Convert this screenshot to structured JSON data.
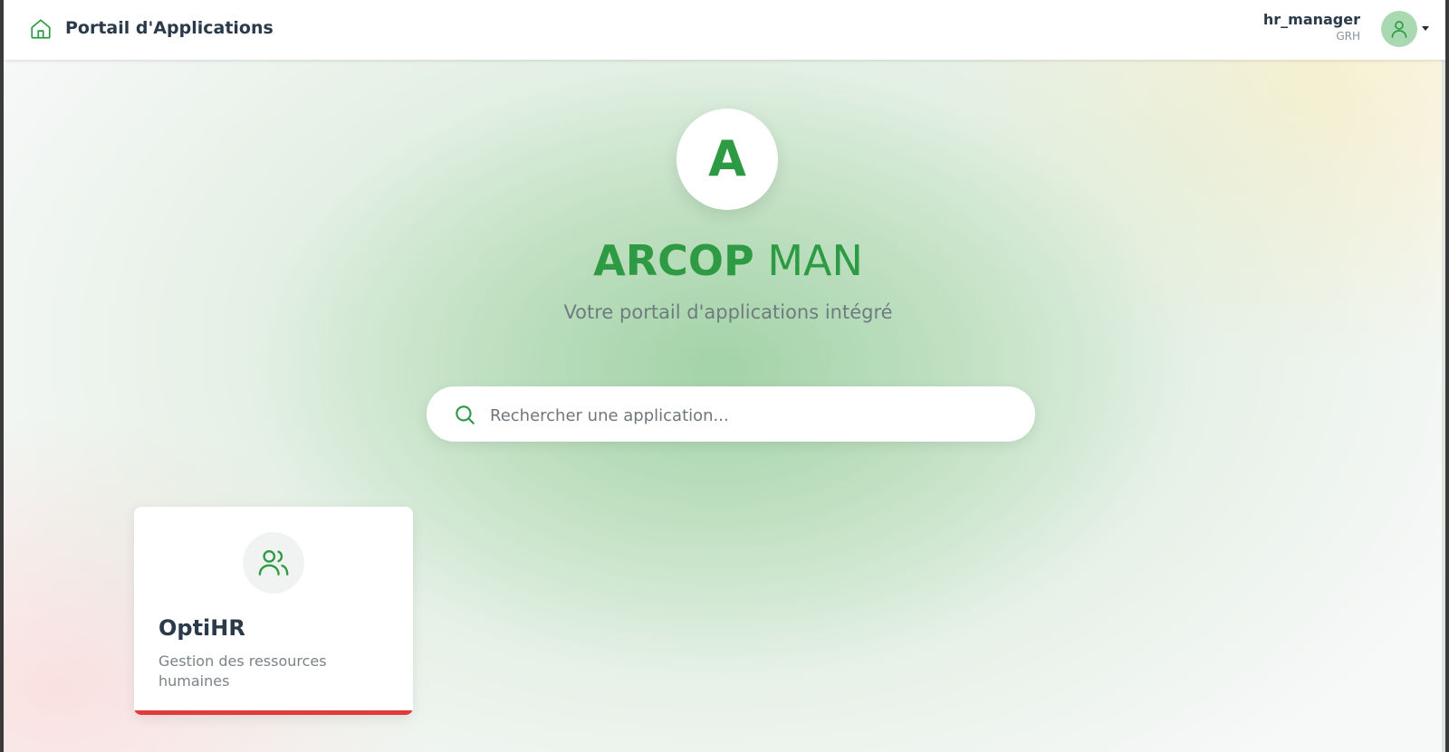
{
  "header": {
    "title": "Portail d'Applications",
    "home_icon": "home-icon",
    "user": {
      "name": "hr_manager",
      "role": "GRH",
      "avatar_icon": "user-icon"
    }
  },
  "hero": {
    "logo_letter": "A",
    "title_bold": "ARCOP",
    "title_light": "MAN",
    "subtitle": "Votre portail d'applications intégré"
  },
  "search": {
    "placeholder": "Rechercher une application...",
    "value": "",
    "icon": "search-icon"
  },
  "apps": [
    {
      "name": "OptiHR",
      "description": "Gestion des ressources humaines",
      "icon": "users-icon",
      "accent_color": "#e03a3a"
    }
  ],
  "colors": {
    "brand_green": "#2e9a44",
    "avatar_bg": "#a9d9b0",
    "card_accent": "#e03a3a"
  }
}
